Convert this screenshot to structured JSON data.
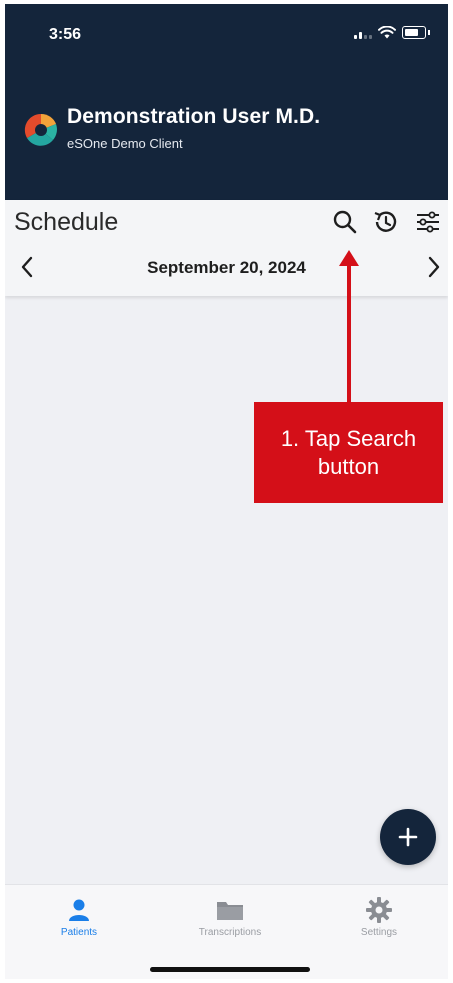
{
  "status_bar": {
    "time": "3:56"
  },
  "header": {
    "user_name": "Demonstration User M.D.",
    "client_name": "eSOne Demo Client"
  },
  "toolbar": {
    "title": "Schedule",
    "date": "September 20, 2024"
  },
  "annotation": {
    "line1": "1. Tap Search",
    "line2": "button",
    "color": "#d40f18"
  },
  "fab": {
    "icon": "plus-icon"
  },
  "tabs": [
    {
      "label": "Patients",
      "icon": "person-icon",
      "active": true
    },
    {
      "label": "Transcriptions",
      "icon": "folder-icon",
      "active": false
    },
    {
      "label": "Settings",
      "icon": "gear-icon",
      "active": false
    }
  ],
  "colors": {
    "header_bg": "#14253b",
    "accent": "#1a7ee8",
    "content_bg": "#eff0f4"
  }
}
